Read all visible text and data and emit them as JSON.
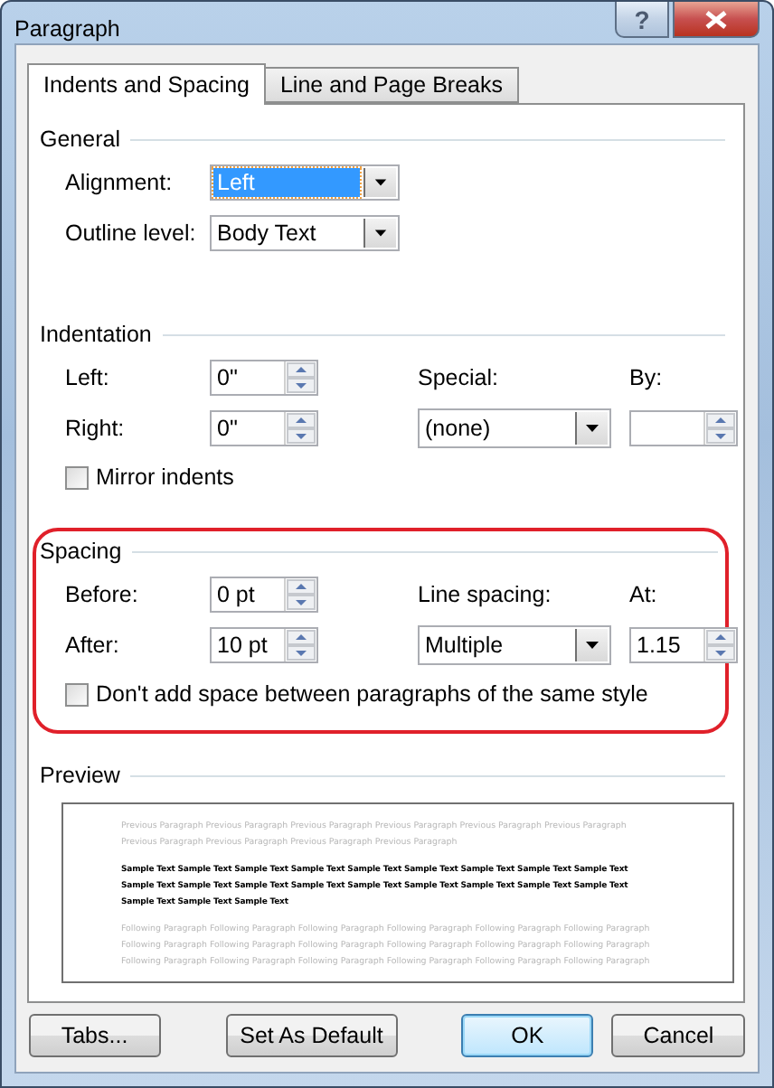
{
  "window": {
    "title": "Paragraph",
    "help": "?"
  },
  "tabs": [
    {
      "label": "Indents and Spacing",
      "selected": true
    },
    {
      "label": "Line and Page Breaks",
      "selected": false
    }
  ],
  "general": {
    "heading": "General",
    "alignment": {
      "label": "Alignment:",
      "value": "Left",
      "highlighted": true
    },
    "outline_level": {
      "label": "Outline level:",
      "value": "Body Text",
      "highlighted": false
    }
  },
  "indentation": {
    "heading": "Indentation",
    "left": {
      "label": "Left:",
      "value": "0\""
    },
    "right": {
      "label": "Right:",
      "value": "0\""
    },
    "special": {
      "label": "Special:",
      "value": "(none)"
    },
    "by": {
      "label": "By:"
    },
    "mirror_indents": {
      "label": "Mirror indents",
      "checked": false
    }
  },
  "spacing": {
    "heading": "Spacing",
    "circled": true,
    "before": {
      "label": "Before:",
      "value": "0 pt"
    },
    "after": {
      "label": "After:",
      "value": "10 pt"
    },
    "line_spacing": {
      "label": "Line spacing:",
      "value": "Multiple"
    },
    "at": {
      "label": "At:",
      "value": "1.15"
    },
    "dont_add_space": {
      "label": "Don't add space between paragraphs of the same style",
      "checked": false
    }
  },
  "preview": {
    "heading": "Preview",
    "previous_lines": [
      "Previous Paragraph Previous Paragraph Previous Paragraph Previous Paragraph Previous Paragraph Previous Paragraph",
      "Previous Paragraph Previous Paragraph Previous Paragraph Previous Paragraph"
    ],
    "sample_lines": [
      "Sample Text Sample Text Sample Text Sample Text Sample Text Sample Text Sample Text Sample Text Sample Text",
      "Sample Text Sample Text Sample Text Sample Text Sample Text Sample Text Sample Text Sample Text Sample Text",
      "Sample Text Sample Text Sample Text"
    ],
    "following_lines": [
      "Following Paragraph Following Paragraph Following Paragraph Following Paragraph Following Paragraph Following Paragraph",
      "Following Paragraph Following Paragraph Following Paragraph Following Paragraph Following Paragraph Following Paragraph",
      "Following Paragraph Following Paragraph Following Paragraph Following Paragraph Following Paragraph Following Paragraph"
    ]
  },
  "buttons": [
    {
      "label": "Tabs...",
      "default": false
    },
    {
      "label": "Set As Default",
      "default": false
    },
    {
      "label": "OK",
      "default": true
    },
    {
      "label": "Cancel",
      "default": false
    }
  ]
}
